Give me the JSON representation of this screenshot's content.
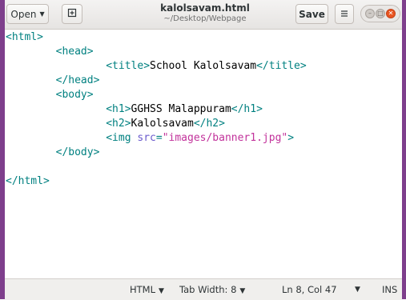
{
  "window": {
    "title": "kalolsavam.html",
    "subtitle": "~/Desktop/Webpage",
    "open_label": "Open",
    "save_label": "Save"
  },
  "editor": {
    "lines": [
      [
        {
          "t": "tag",
          "s": "<html>"
        }
      ],
      [
        {
          "t": "txt",
          "s": "        "
        },
        {
          "t": "tag",
          "s": "<head>"
        }
      ],
      [
        {
          "t": "txt",
          "s": "                "
        },
        {
          "t": "tag",
          "s": "<title>"
        },
        {
          "t": "txt",
          "s": "School Kalolsavam"
        },
        {
          "t": "tag",
          "s": "</title>"
        }
      ],
      [
        {
          "t": "txt",
          "s": "        "
        },
        {
          "t": "tag",
          "s": "</head>"
        }
      ],
      [
        {
          "t": "txt",
          "s": "        "
        },
        {
          "t": "tag",
          "s": "<body>"
        }
      ],
      [
        {
          "t": "txt",
          "s": "                "
        },
        {
          "t": "tag",
          "s": "<h1>"
        },
        {
          "t": "txt",
          "s": "GGHSS Malappuram"
        },
        {
          "t": "tag",
          "s": "</h1>"
        }
      ],
      [
        {
          "t": "txt",
          "s": "                "
        },
        {
          "t": "tag",
          "s": "<h2>"
        },
        {
          "t": "txt",
          "s": "Kalolsavam"
        },
        {
          "t": "tag",
          "s": "</h2>"
        }
      ],
      [
        {
          "t": "txt",
          "s": "                "
        },
        {
          "t": "tag",
          "s": "<img "
        },
        {
          "t": "attr",
          "s": "src"
        },
        {
          "t": "tag",
          "s": "="
        },
        {
          "t": "str",
          "s": "\"images/banner1.jpg\""
        },
        {
          "t": "tag",
          "s": ">"
        }
      ],
      [
        {
          "t": "txt",
          "s": "        "
        },
        {
          "t": "tag",
          "s": "</body>"
        }
      ],
      [
        {
          "t": "txt",
          "s": ""
        }
      ],
      [
        {
          "t": "tag",
          "s": "</html>"
        }
      ]
    ]
  },
  "statusbar": {
    "language": "HTML",
    "tab_width": "Tab Width: 8",
    "position": "Ln 8, Col 47",
    "mode": "INS"
  },
  "icons": {
    "new_tab": "new-tab-icon",
    "menu": "hamburger-menu-icon",
    "minimize": "minimize-icon",
    "maximize": "maximize-icon",
    "close": "close-icon"
  },
  "colors": {
    "frame": "#7e3f8c",
    "tag": "#008080",
    "attr": "#6a5acd",
    "string": "#c2329b",
    "close_button": "#e95420"
  }
}
